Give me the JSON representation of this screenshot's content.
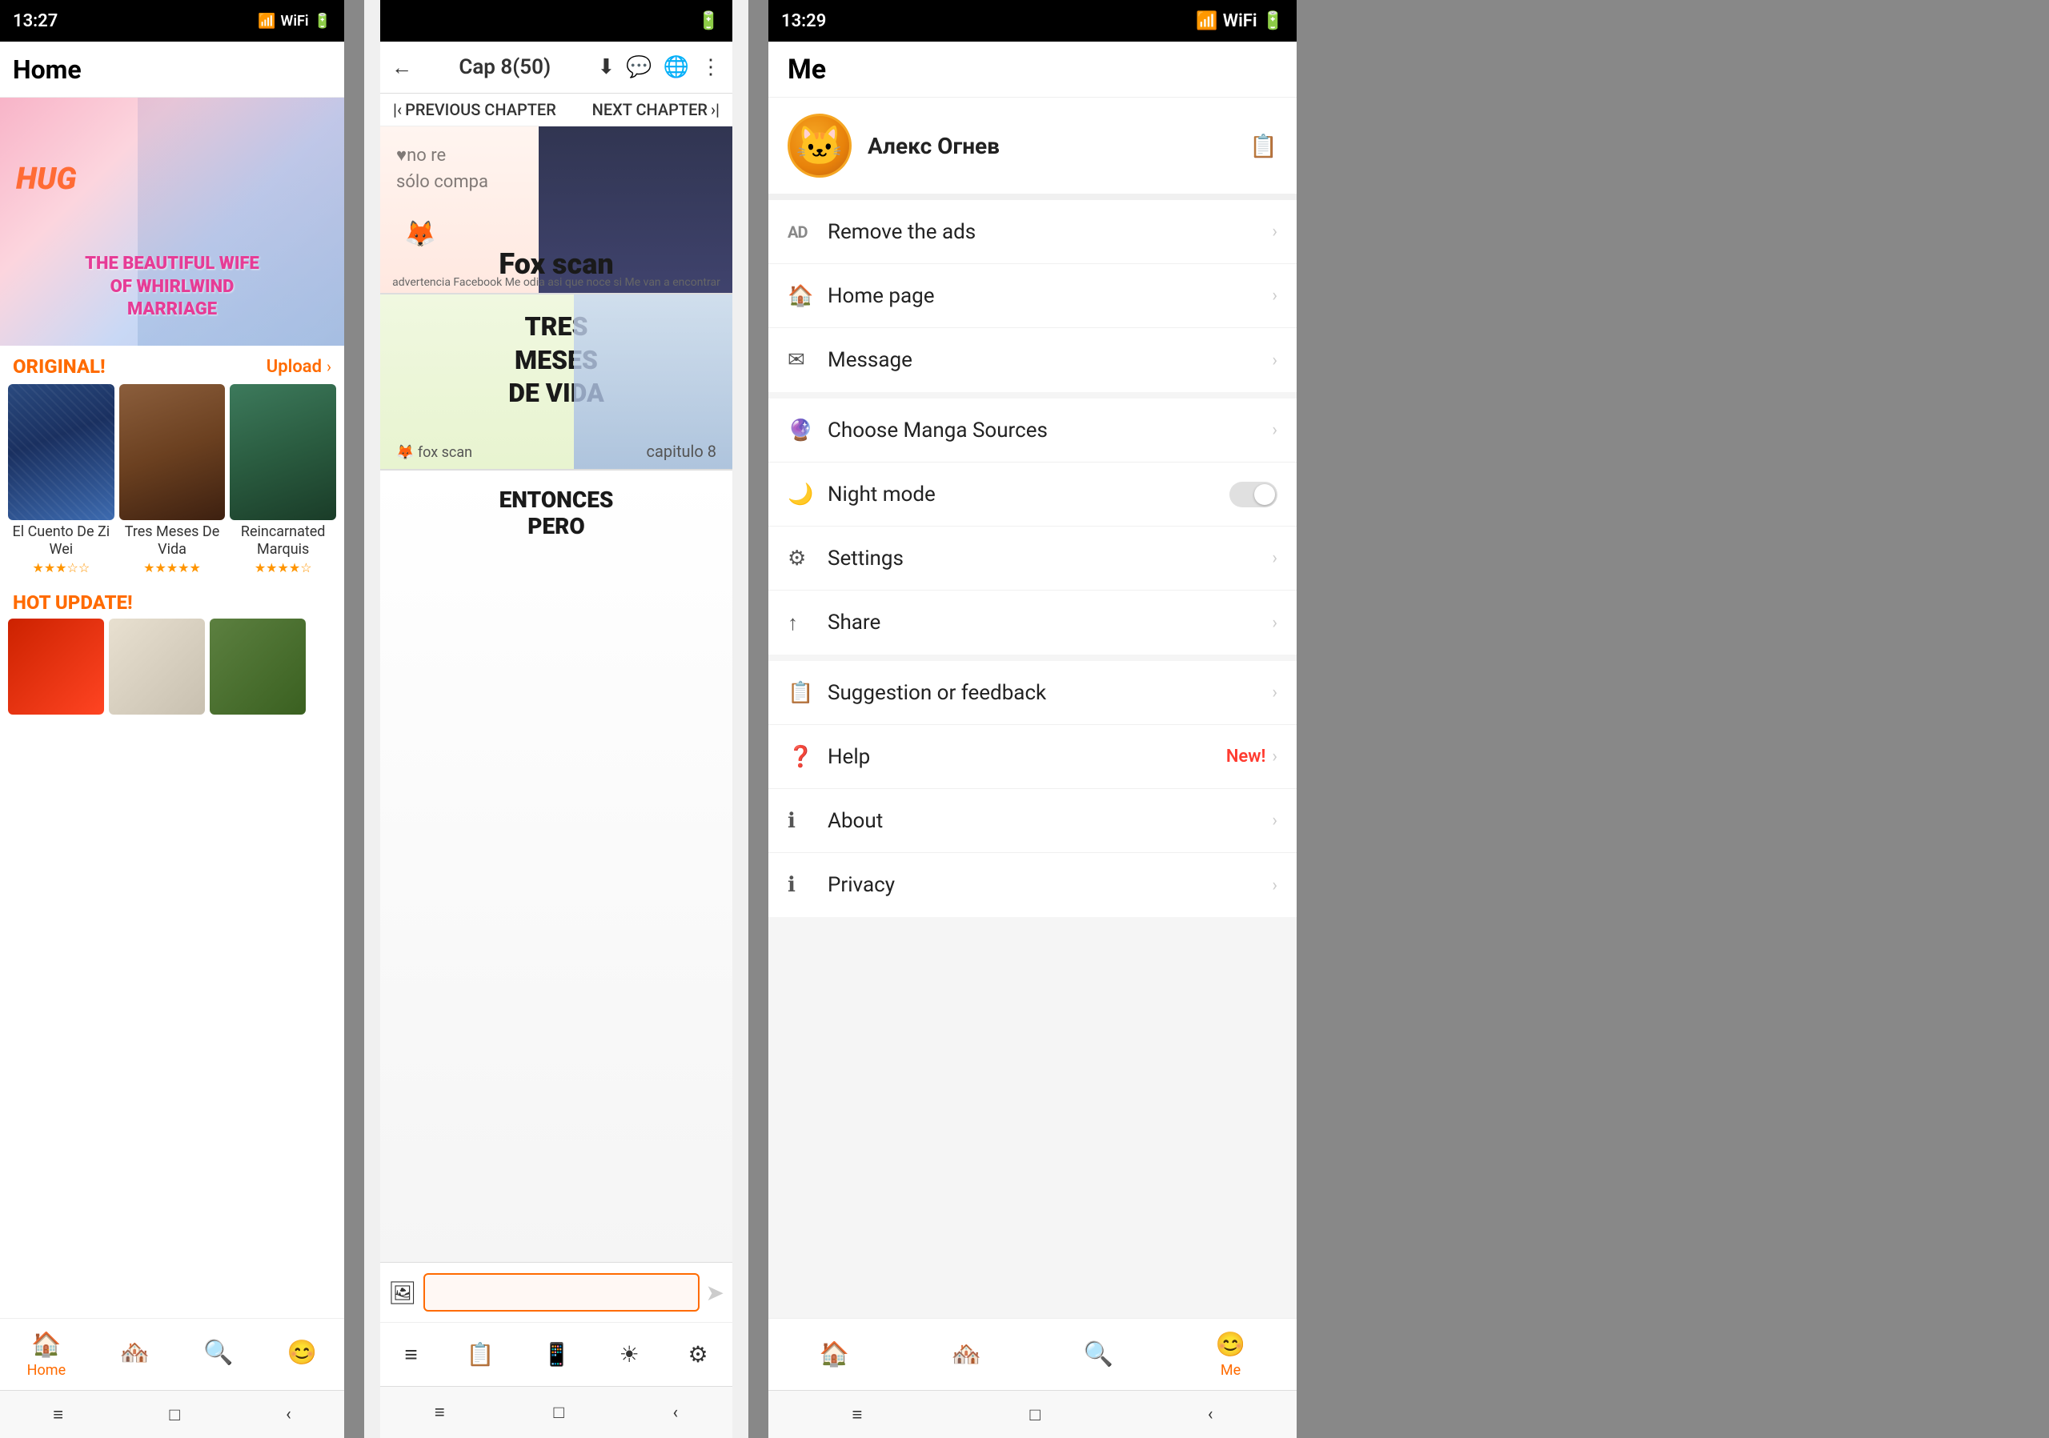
{
  "home": {
    "status_time": "13:27",
    "title": "Home",
    "banner_hug": "HUG",
    "banner_subtitle": "THE BEAUTIFUL WIFE\nOF WHIRLWIND\nMARRIAGE",
    "section_original": "ORIGINAL!",
    "section_upload": "Upload",
    "manga_items": [
      {
        "title": "El Cuento De Zi Wei",
        "stars": "★★★☆☆",
        "cover_class": "manga-cover-1"
      },
      {
        "title": "Tres Meses De Vida",
        "stars": "★★★★★",
        "cover_class": "manga-cover-2"
      },
      {
        "title": "Reincarnated Marquis",
        "stars": "★★★★☆",
        "cover_class": "manga-cover-3"
      }
    ],
    "hot_update_title": "HOT UPDATE!",
    "tabs": [
      {
        "label": "Home",
        "icon": "🏠",
        "active": true
      },
      {
        "label": "",
        "icon": "🏘️",
        "active": false
      },
      {
        "label": "",
        "icon": "🔍",
        "active": false
      },
      {
        "label": "",
        "icon": "😊",
        "active": false
      }
    ]
  },
  "reader": {
    "status_time": "",
    "back_icon": "←",
    "title": "Cap 8(50)",
    "icons": [
      "⬇",
      "💬",
      "🌐",
      "⋮"
    ],
    "prev_chapter": "PREVIOUS CHAPTER",
    "next_chapter": "NEXT CHAPTER",
    "watermark_line1": "♥no re",
    "watermark_line2": "sólo compa",
    "fox_scan_label": "Fox scan",
    "ad_notice": "advertencia Facebook Me odia asi que noce si Me van a encontrar",
    "tres_meses": "TRES\nMESES\nDE VIDA",
    "capitulo": "capitulo 8",
    "entonces": "ENTONCES\nPERO",
    "search_placeholder": "",
    "bottom_tabs": [
      "📷",
      "≡",
      "📋",
      "📱",
      "☀",
      "⚙"
    ]
  },
  "me": {
    "status_time": "13:29",
    "title": "Me",
    "user_name": "Алекс Огнев",
    "menu_items": [
      {
        "id": "remove-ads",
        "icon": "AD",
        "label": "Remove the ads",
        "type": "chevron"
      },
      {
        "id": "home-page",
        "icon": "🏠",
        "label": "Home page",
        "type": "chevron"
      },
      {
        "id": "message",
        "icon": "✉",
        "label": "Message",
        "type": "chevron"
      },
      {
        "id": "choose-sources",
        "icon": "🔮",
        "label": "Choose Manga Sources",
        "type": "chevron"
      },
      {
        "id": "night-mode",
        "icon": "🌙",
        "label": "Night mode",
        "type": "toggle"
      },
      {
        "id": "settings",
        "icon": "⚙",
        "label": "Settings",
        "type": "chevron"
      },
      {
        "id": "share",
        "icon": "↑",
        "label": "Share",
        "type": "chevron"
      },
      {
        "id": "suggestion",
        "icon": "📋",
        "label": "Suggestion or feedback",
        "type": "chevron"
      },
      {
        "id": "help",
        "icon": "❓",
        "label": "Help",
        "badge": "New!",
        "type": "chevron"
      },
      {
        "id": "about",
        "icon": "ℹ",
        "label": "About",
        "type": "chevron"
      },
      {
        "id": "privacy",
        "icon": "ℹ",
        "label": "Privacy",
        "type": "chevron"
      }
    ],
    "tabs": [
      {
        "label": "",
        "icon": "🏠",
        "active": false
      },
      {
        "label": "",
        "icon": "🏘️",
        "active": false
      },
      {
        "label": "",
        "icon": "🔍",
        "active": false
      },
      {
        "label": "Me",
        "icon": "😊",
        "active": true
      }
    ]
  }
}
